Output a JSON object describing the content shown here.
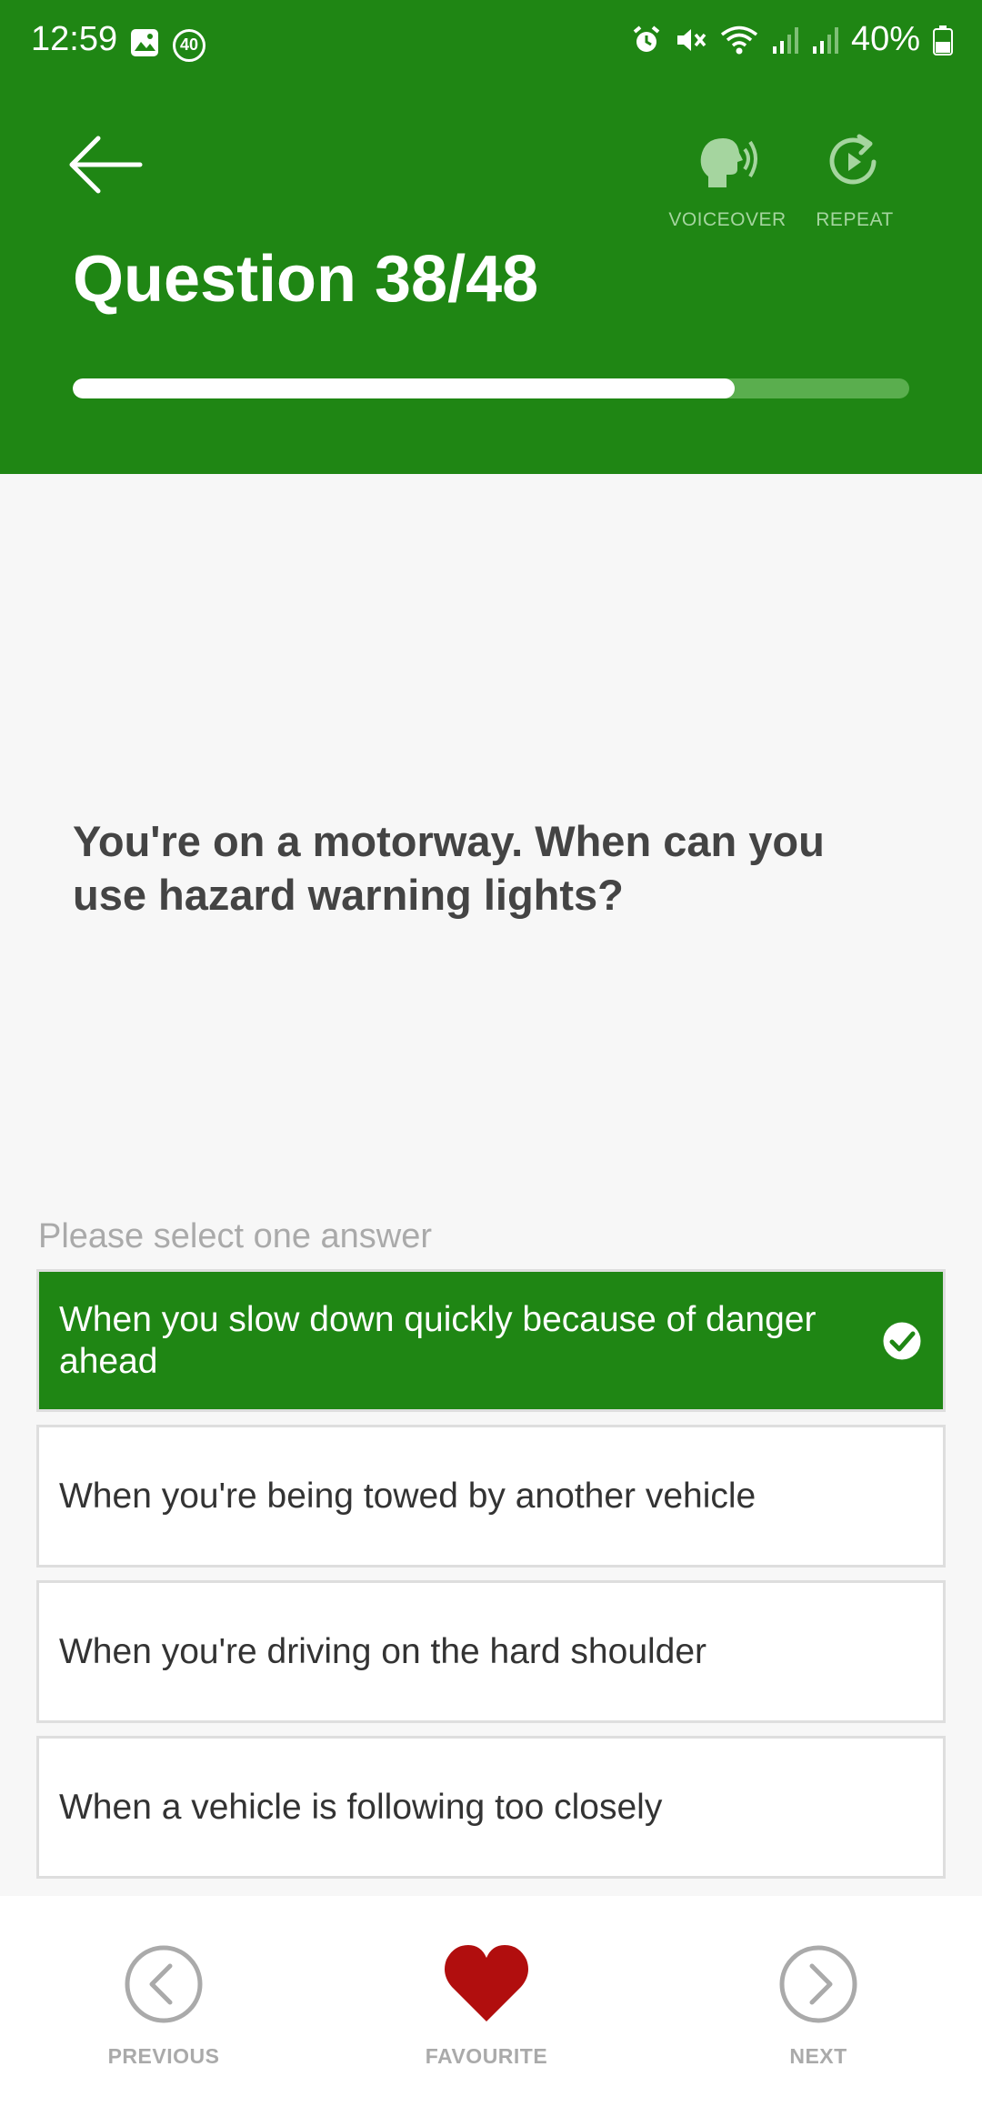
{
  "status_bar": {
    "time": "12:59",
    "notification_badge": "40",
    "battery": "40%",
    "icons": [
      "gallery-icon",
      "badge-40-icon",
      "alarm-icon",
      "mute-icon",
      "wifi-icon",
      "signal-icon",
      "signal-icon",
      "battery-icon"
    ]
  },
  "header": {
    "title": "Question 38/48",
    "progress": 0.7917,
    "voiceover_label": "VOICEOVER",
    "repeat_label": "REPEAT"
  },
  "question": {
    "text": "You're on a motorway. When can you use hazard warning lights?",
    "instructions": "Please select one answer"
  },
  "answers": [
    {
      "text": "When you slow down quickly because of danger ahead",
      "selected": true
    },
    {
      "text": "When you're being towed by another vehicle",
      "selected": false
    },
    {
      "text": "When you're driving on the hard shoulder",
      "selected": false
    },
    {
      "text": "When a vehicle is following too closely",
      "selected": false
    }
  ],
  "bottom_nav": {
    "previous_label": "PREVIOUS",
    "favourite_label": "FAVOURITE",
    "next_label": "NEXT"
  },
  "colors": {
    "brand_green": "#1f8614",
    "favourite_red": "#b10e0e",
    "muted_grey": "#aaaaaa"
  }
}
